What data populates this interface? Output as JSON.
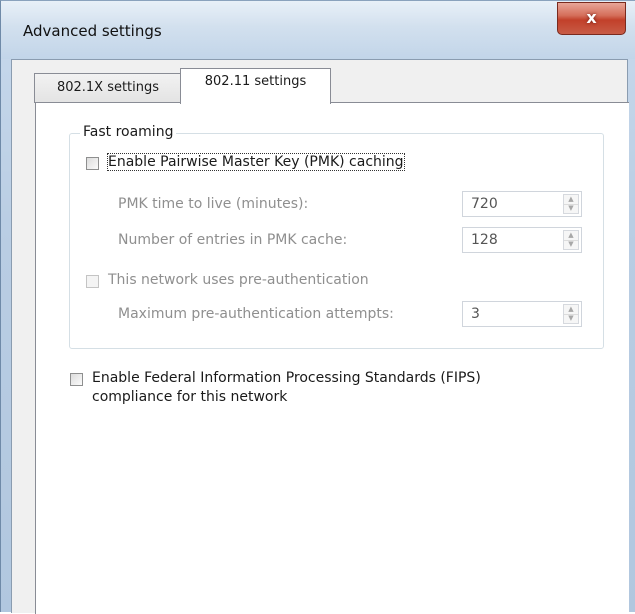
{
  "window": {
    "title": "Advanced settings",
    "close_symbol": "x"
  },
  "tabs": [
    {
      "label": "802.1X settings",
      "active": false
    },
    {
      "label": "802.11 settings",
      "active": true
    }
  ],
  "fast_roaming": {
    "legend": "Fast roaming",
    "pmk_caching": {
      "label": "Enable Pairwise Master Key (PMK) caching",
      "checked": false
    },
    "pmk_ttl": {
      "label": "PMK time to live (minutes):",
      "value": "720"
    },
    "pmk_entries": {
      "label": "Number of entries in PMK cache:",
      "value": "128"
    },
    "preauth": {
      "label": "This network uses pre-authentication",
      "checked": false
    },
    "preauth_attempts": {
      "label": "Maximum pre-authentication attempts:",
      "value": "3"
    }
  },
  "fips": {
    "label_line1": "Enable Federal Information Processing Standards (FIPS)",
    "label_line2": "compliance for this network",
    "checked": false
  },
  "icons": {
    "spin_up": "▲",
    "spin_down": "▼"
  }
}
